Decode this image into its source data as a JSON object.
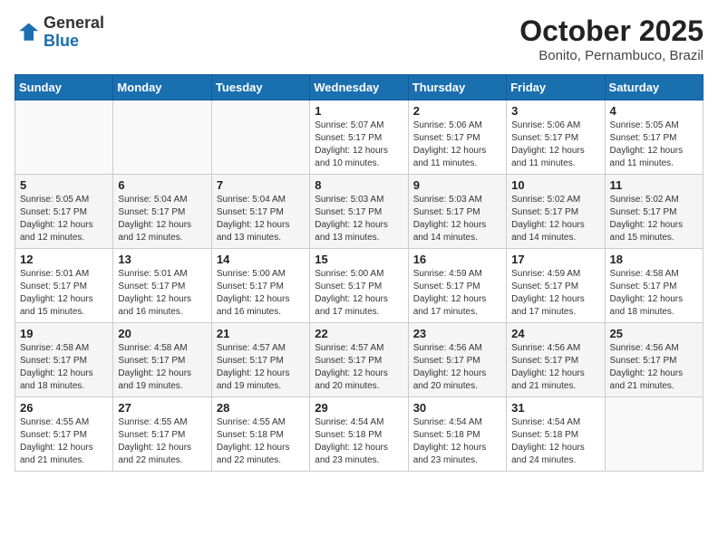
{
  "logo": {
    "general": "General",
    "blue": "Blue"
  },
  "header": {
    "month": "October 2025",
    "location": "Bonito, Pernambuco, Brazil"
  },
  "weekdays": [
    "Sunday",
    "Monday",
    "Tuesday",
    "Wednesday",
    "Thursday",
    "Friday",
    "Saturday"
  ],
  "weeks": [
    [
      {
        "day": "",
        "info": ""
      },
      {
        "day": "",
        "info": ""
      },
      {
        "day": "",
        "info": ""
      },
      {
        "day": "1",
        "info": "Sunrise: 5:07 AM\nSunset: 5:17 PM\nDaylight: 12 hours\nand 10 minutes."
      },
      {
        "day": "2",
        "info": "Sunrise: 5:06 AM\nSunset: 5:17 PM\nDaylight: 12 hours\nand 11 minutes."
      },
      {
        "day": "3",
        "info": "Sunrise: 5:06 AM\nSunset: 5:17 PM\nDaylight: 12 hours\nand 11 minutes."
      },
      {
        "day": "4",
        "info": "Sunrise: 5:05 AM\nSunset: 5:17 PM\nDaylight: 12 hours\nand 11 minutes."
      }
    ],
    [
      {
        "day": "5",
        "info": "Sunrise: 5:05 AM\nSunset: 5:17 PM\nDaylight: 12 hours\nand 12 minutes."
      },
      {
        "day": "6",
        "info": "Sunrise: 5:04 AM\nSunset: 5:17 PM\nDaylight: 12 hours\nand 12 minutes."
      },
      {
        "day": "7",
        "info": "Sunrise: 5:04 AM\nSunset: 5:17 PM\nDaylight: 12 hours\nand 13 minutes."
      },
      {
        "day": "8",
        "info": "Sunrise: 5:03 AM\nSunset: 5:17 PM\nDaylight: 12 hours\nand 13 minutes."
      },
      {
        "day": "9",
        "info": "Sunrise: 5:03 AM\nSunset: 5:17 PM\nDaylight: 12 hours\nand 14 minutes."
      },
      {
        "day": "10",
        "info": "Sunrise: 5:02 AM\nSunset: 5:17 PM\nDaylight: 12 hours\nand 14 minutes."
      },
      {
        "day": "11",
        "info": "Sunrise: 5:02 AM\nSunset: 5:17 PM\nDaylight: 12 hours\nand 15 minutes."
      }
    ],
    [
      {
        "day": "12",
        "info": "Sunrise: 5:01 AM\nSunset: 5:17 PM\nDaylight: 12 hours\nand 15 minutes."
      },
      {
        "day": "13",
        "info": "Sunrise: 5:01 AM\nSunset: 5:17 PM\nDaylight: 12 hours\nand 16 minutes."
      },
      {
        "day": "14",
        "info": "Sunrise: 5:00 AM\nSunset: 5:17 PM\nDaylight: 12 hours\nand 16 minutes."
      },
      {
        "day": "15",
        "info": "Sunrise: 5:00 AM\nSunset: 5:17 PM\nDaylight: 12 hours\nand 17 minutes."
      },
      {
        "day": "16",
        "info": "Sunrise: 4:59 AM\nSunset: 5:17 PM\nDaylight: 12 hours\nand 17 minutes."
      },
      {
        "day": "17",
        "info": "Sunrise: 4:59 AM\nSunset: 5:17 PM\nDaylight: 12 hours\nand 17 minutes."
      },
      {
        "day": "18",
        "info": "Sunrise: 4:58 AM\nSunset: 5:17 PM\nDaylight: 12 hours\nand 18 minutes."
      }
    ],
    [
      {
        "day": "19",
        "info": "Sunrise: 4:58 AM\nSunset: 5:17 PM\nDaylight: 12 hours\nand 18 minutes."
      },
      {
        "day": "20",
        "info": "Sunrise: 4:58 AM\nSunset: 5:17 PM\nDaylight: 12 hours\nand 19 minutes."
      },
      {
        "day": "21",
        "info": "Sunrise: 4:57 AM\nSunset: 5:17 PM\nDaylight: 12 hours\nand 19 minutes."
      },
      {
        "day": "22",
        "info": "Sunrise: 4:57 AM\nSunset: 5:17 PM\nDaylight: 12 hours\nand 20 minutes."
      },
      {
        "day": "23",
        "info": "Sunrise: 4:56 AM\nSunset: 5:17 PM\nDaylight: 12 hours\nand 20 minutes."
      },
      {
        "day": "24",
        "info": "Sunrise: 4:56 AM\nSunset: 5:17 PM\nDaylight: 12 hours\nand 21 minutes."
      },
      {
        "day": "25",
        "info": "Sunrise: 4:56 AM\nSunset: 5:17 PM\nDaylight: 12 hours\nand 21 minutes."
      }
    ],
    [
      {
        "day": "26",
        "info": "Sunrise: 4:55 AM\nSunset: 5:17 PM\nDaylight: 12 hours\nand 21 minutes."
      },
      {
        "day": "27",
        "info": "Sunrise: 4:55 AM\nSunset: 5:17 PM\nDaylight: 12 hours\nand 22 minutes."
      },
      {
        "day": "28",
        "info": "Sunrise: 4:55 AM\nSunset: 5:18 PM\nDaylight: 12 hours\nand 22 minutes."
      },
      {
        "day": "29",
        "info": "Sunrise: 4:54 AM\nSunset: 5:18 PM\nDaylight: 12 hours\nand 23 minutes."
      },
      {
        "day": "30",
        "info": "Sunrise: 4:54 AM\nSunset: 5:18 PM\nDaylight: 12 hours\nand 23 minutes."
      },
      {
        "day": "31",
        "info": "Sunrise: 4:54 AM\nSunset: 5:18 PM\nDaylight: 12 hours\nand 24 minutes."
      },
      {
        "day": "",
        "info": ""
      }
    ]
  ]
}
